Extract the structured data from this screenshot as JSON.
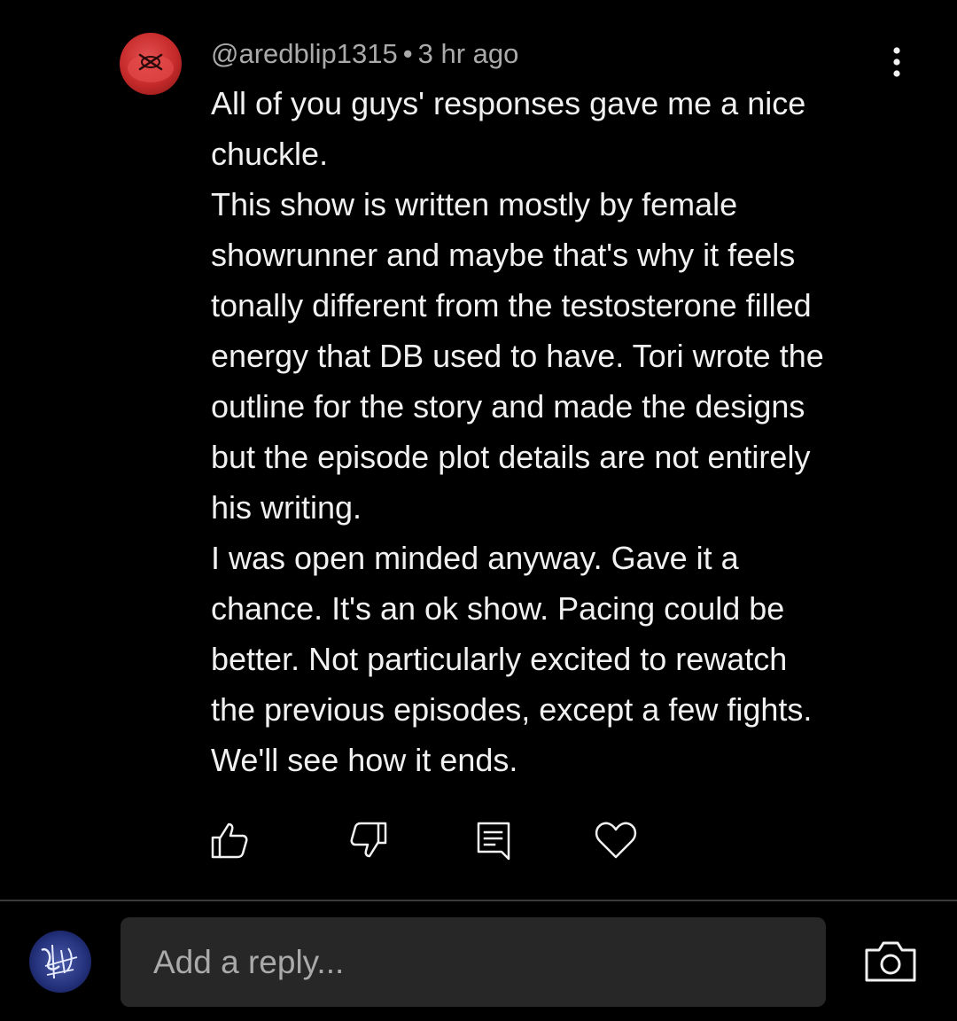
{
  "comment": {
    "author": "@aredblip1315",
    "separator": "•",
    "time": "3 hr ago",
    "lines": [
      "All of you guys' responses gave me a nice",
      "chuckle.",
      "This show is written mostly by female",
      "showrunner and maybe that's why it feels",
      "tonally different from the testosterone filled",
      "energy that DB used to have. Tori wrote the",
      "outline for the story and made the designs",
      "but the episode plot details are not entirely",
      "his writing.",
      "I was open minded anyway. Gave it a",
      "chance. It's an ok show. Pacing could be",
      "better. Not particularly excited to rewatch",
      "the previous episodes, except a few fights.",
      "We'll see how it ends."
    ],
    "author_avatar_icon": "red-face-avatar",
    "more_icon": "more-vert-icon"
  },
  "actions": [
    {
      "name": "like",
      "icon": "thumb-up-icon"
    },
    {
      "name": "dislike",
      "icon": "thumb-down-icon"
    },
    {
      "name": "reply",
      "icon": "comment-icon"
    },
    {
      "name": "heart",
      "icon": "heart-icon"
    }
  ],
  "reply": {
    "placeholder": "Add a reply...",
    "value": "",
    "camera_icon": "camera-icon",
    "user_avatar_icon": "user-avatar"
  },
  "colors": {
    "background": "#000000",
    "text_primary": "#f1f1f1",
    "text_secondary": "#aaaaaa",
    "input_background": "#272727",
    "divider": "#3a3a3a",
    "author_avatar": "#c62a2a"
  }
}
